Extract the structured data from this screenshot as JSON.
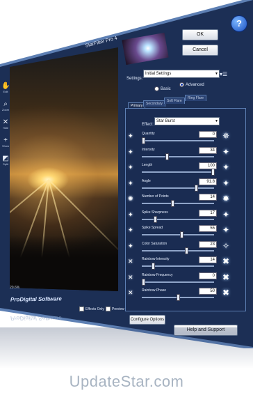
{
  "window": {
    "title": "StarFilter Pro 4"
  },
  "toolbar": [
    {
      "icon": "hand-icon",
      "label": "Edit"
    },
    {
      "icon": "magnifier-icon",
      "label": "Zoom"
    },
    {
      "icon": "cross-icon",
      "label": "Hide"
    },
    {
      "icon": "plus-icon",
      "label": "Show"
    },
    {
      "icon": "split-icon",
      "label": "Split"
    }
  ],
  "buttons": {
    "ok": "OK",
    "cancel": "Cancel",
    "help": "?",
    "configure": "Configure Options",
    "help_support": "Help and Support"
  },
  "settings": {
    "label": "Settings:",
    "value": "Initial Settings"
  },
  "mode": {
    "basic": "Basic",
    "advanced": "Advanced",
    "selected": "Advanced"
  },
  "tabs": [
    "Primary",
    "Secondary",
    "Soft Flare",
    "Ring Flare"
  ],
  "effect": {
    "label": "Effect:",
    "value": "Star Burst"
  },
  "params": [
    {
      "name": "Quantity",
      "value": "0",
      "pos": 0.0
    },
    {
      "name": "Intensity",
      "value": "34",
      "pos": 0.34
    },
    {
      "name": "Length",
      "value": "100",
      "pos": 1.0
    },
    {
      "name": "Angle",
      "value": "91.8",
      "pos": 0.76
    },
    {
      "name": "Number of Points",
      "value": "14",
      "pos": 0.42
    },
    {
      "name": "Spike Sharpness",
      "value": "17",
      "pos": 0.17
    },
    {
      "name": "Spike Spread",
      "value": "55",
      "pos": 0.55
    },
    {
      "name": "Color Saturation",
      "value": "23",
      "pos": 0.62
    },
    {
      "name": "Rainbow Intensity",
      "value": "14",
      "pos": 0.14
    },
    {
      "name": "Rainbow Frequency",
      "value": "0",
      "pos": 0.0
    },
    {
      "name": "Rainbow Phase",
      "value": "50",
      "pos": 0.5
    }
  ],
  "preview": {
    "zoom": "20.6%",
    "effects_only": "Effects Only",
    "preview": "Preview",
    "logo": "ProDigital Software"
  },
  "footer": {
    "text": "UpdateStar.com"
  }
}
